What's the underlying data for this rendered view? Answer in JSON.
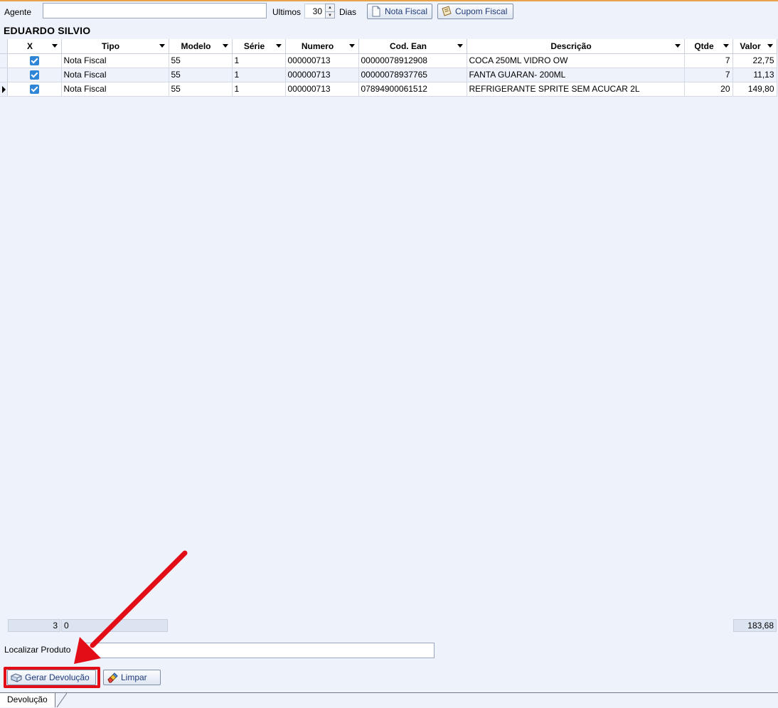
{
  "toolbar": {
    "agent_label": "Agente",
    "agent_value": "",
    "ultimos_label": "Ultimos",
    "days_value": "30",
    "dias_label": "Dias",
    "nota_fiscal_button": "Nota Fiscal",
    "cupom_fiscal_button": "Cupom Fiscal"
  },
  "customer_name": "EDUARDO SILVIO",
  "grid": {
    "columns": [
      "X",
      "Tipo",
      "Modelo",
      "Série",
      "Numero",
      "Cod. Ean",
      "Descrição",
      "Qtde",
      "Valor"
    ],
    "rows": [
      {
        "checked": true,
        "tipo": "Nota Fiscal",
        "modelo": "55",
        "serie": "1",
        "numero": "000000713",
        "cod_ean": "00000078912908",
        "descricao": "COCA 250ML VIDRO OW",
        "qtde": "7",
        "valor": "22,75"
      },
      {
        "checked": true,
        "tipo": "Nota Fiscal",
        "modelo": "55",
        "serie": "1",
        "numero": "000000713",
        "cod_ean": "00000078937765",
        "descricao": "FANTA GUARAN- 200ML",
        "qtde": "7",
        "valor": "11,13"
      },
      {
        "checked": true,
        "tipo": "Nota Fiscal",
        "modelo": "55",
        "serie": "1",
        "numero": "000000713",
        "cod_ean": "07894900061512",
        "descricao": "REFRIGERANTE SPRITE SEM ACUCAR 2L",
        "qtde": "20",
        "valor": "149,80"
      }
    ],
    "footer": {
      "count": "3",
      "tipo_total": "0",
      "valor_total": "183,68"
    }
  },
  "search": {
    "label": "Localizar Produto",
    "value": ""
  },
  "actions": {
    "gerar_devolucao": "Gerar Devolução",
    "limpar": "Limpar"
  },
  "tabs": [
    {
      "label": "Devolução"
    }
  ],
  "colors": {
    "highlight": "#e20d17",
    "background": "#eef2fb",
    "accent": "#e8a24a",
    "checkbox": "#2f86d6"
  }
}
